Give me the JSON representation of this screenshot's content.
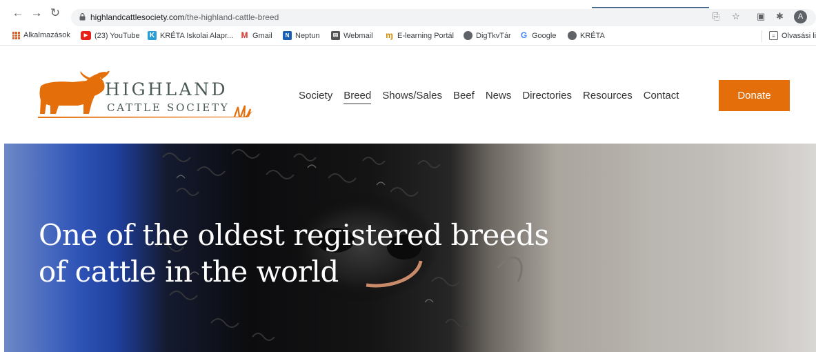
{
  "browser": {
    "url_host": "highlandcattlesociety.com",
    "url_path": "/the-highland-cattle-breed",
    "avatar_letter": "A"
  },
  "bookmarks": {
    "items": [
      {
        "label": "Alkalmazások",
        "icon": "apps-grid-icon"
      },
      {
        "label": "(23) YouTube",
        "icon": "youtube-icon",
        "color": "#e62117"
      },
      {
        "label": "KRÉTA Iskolai Alapr...",
        "icon": "kreta-icon",
        "color": "#2a9fd6"
      },
      {
        "label": "Gmail",
        "icon": "gmail-icon",
        "color": "#d93025"
      },
      {
        "label": "Neptun",
        "icon": "neptun-icon",
        "color": "#1a5fb4"
      },
      {
        "label": "Webmail",
        "icon": "webmail-icon",
        "color": "#555555"
      },
      {
        "label": "E-learning Portál",
        "icon": "elearning-icon",
        "color": "#d48a00"
      },
      {
        "label": "DigTkvTár",
        "icon": "globe-icon"
      },
      {
        "label": "Google",
        "icon": "google-icon",
        "color": "#4285f4"
      },
      {
        "label": "KRÉTA",
        "icon": "globe-icon"
      }
    ],
    "reading_list": "Olvasási lis"
  },
  "site": {
    "logo_line1": "HIGHLAND",
    "logo_line2": "CATTLE SOCIETY",
    "nav": [
      "Society",
      "Breed",
      "Shows/Sales",
      "Beef",
      "News",
      "Directories",
      "Resources",
      "Contact"
    ],
    "active_nav": "Breed",
    "donate_label": "Donate",
    "accent_color": "#e46e0a"
  },
  "hero": {
    "title_line1": "One of the oldest registered breeds",
    "title_line2": "of cattle in the world"
  }
}
